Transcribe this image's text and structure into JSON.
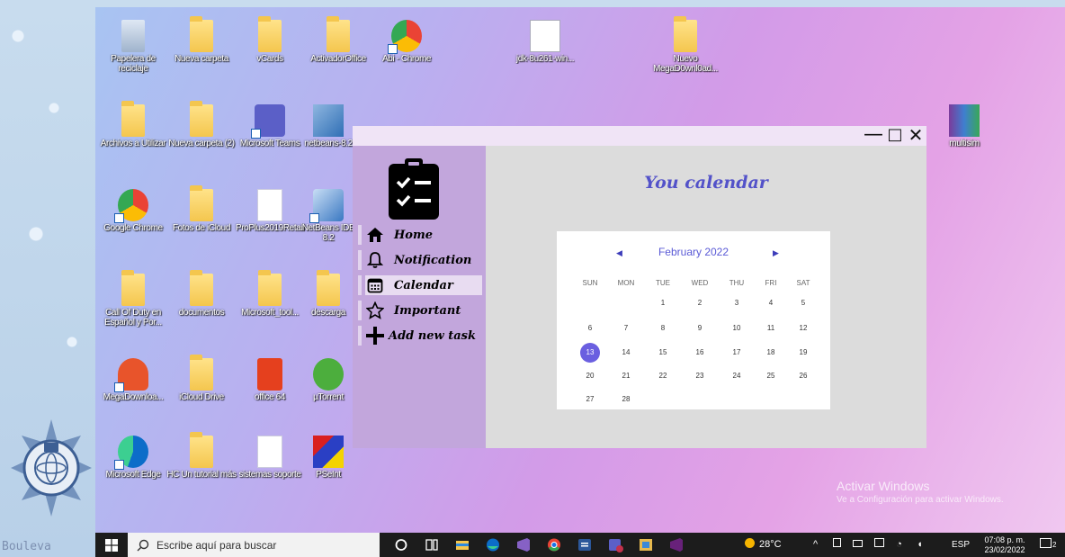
{
  "desktop": {
    "icons": [
      {
        "label": "Papelera de reciclaje"
      },
      {
        "label": "Nueva carpeta"
      },
      {
        "label": "vCards"
      },
      {
        "label": "ActivadorOffice"
      },
      {
        "label": "Abi - Chrome"
      },
      {
        "label": "jdk-8u261-win..."
      },
      {
        "label": "Nuevo MegaD0wnl0ad..."
      },
      {
        "label": "Archivos a Utilizar"
      },
      {
        "label": "Nueva carpeta (2)"
      },
      {
        "label": "Microsoft Teams"
      },
      {
        "label": "netbeans-8.2"
      },
      {
        "label": "multisim"
      },
      {
        "label": "Google Chrome"
      },
      {
        "label": "Fotos de iCloud"
      },
      {
        "label": "ProPlus2019Retail"
      },
      {
        "label": "NetBeans IDE 8.2"
      },
      {
        "label": "Call Of Duty en Español y Por..."
      },
      {
        "label": "documentos"
      },
      {
        "label": "Microsoft_tool..."
      },
      {
        "label": "descarga"
      },
      {
        "label": "MegaDownloa..."
      },
      {
        "label": "iCloud Drive"
      },
      {
        "label": "office 64"
      },
      {
        "label": "µTorrent"
      },
      {
        "label": "Microsoft Edge"
      },
      {
        "label": "HC Un tutorial más"
      },
      {
        "label": "sistemas soporte"
      },
      {
        "label": "PSeInt"
      }
    ],
    "edge_text": "Bouleva"
  },
  "window": {
    "controls": {
      "minimize": "—",
      "maximize": "□",
      "close": "✕"
    },
    "nav": [
      {
        "label": "Home",
        "icon": "home-icon"
      },
      {
        "label": "Notification",
        "icon": "bell-icon"
      },
      {
        "label": "Calendar",
        "icon": "calendar-icon"
      },
      {
        "label": "Important",
        "icon": "star-icon"
      },
      {
        "label": "Add new task",
        "icon": "plus-icon"
      }
    ],
    "active_nav": "Calendar",
    "title": "You calendar",
    "calendar": {
      "month": "February 2022",
      "weekdays": [
        "SUN",
        "MON",
        "TUE",
        "WED",
        "THU",
        "FRI",
        "SAT"
      ],
      "weeks": [
        [
          "",
          "",
          "1",
          "2",
          "3",
          "4",
          "5"
        ],
        [
          "6",
          "7",
          "8",
          "9",
          "10",
          "11",
          "12"
        ],
        [
          "13",
          "14",
          "15",
          "16",
          "17",
          "18",
          "19"
        ],
        [
          "20",
          "21",
          "22",
          "23",
          "24",
          "25",
          "26"
        ],
        [
          "27",
          "28",
          "",
          "",
          "",
          "",
          ""
        ]
      ],
      "selected": "13",
      "accent": "#6a5fe0"
    }
  },
  "watermark": {
    "line1": "Activar Windows",
    "line2": "Ve a Configuración para activar Windows."
  },
  "taskbar": {
    "search_placeholder": "Escribe aquí para buscar",
    "weather": "28°C",
    "language": "ESP",
    "time": "07:08 p. m.",
    "date": "23/02/2022",
    "notification_count": "2"
  }
}
